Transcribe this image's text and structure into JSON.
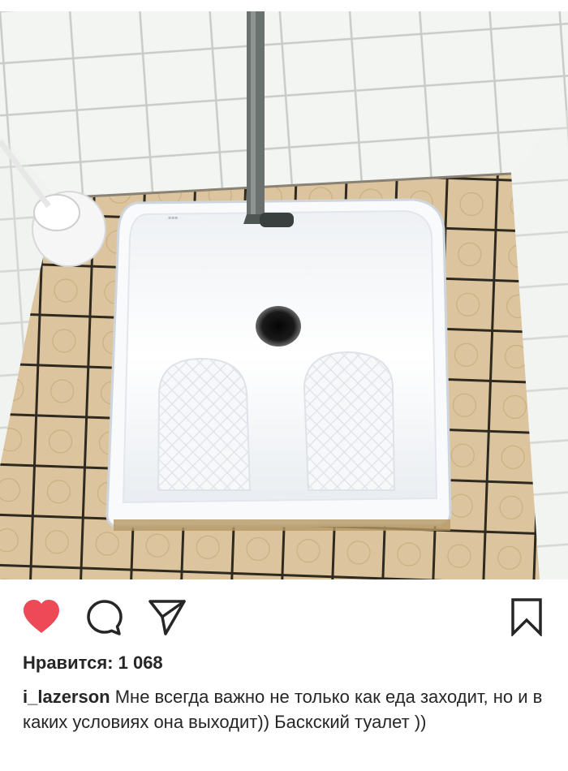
{
  "post": {
    "photo": {
      "icon": "squat-toilet-photo",
      "colors": {
        "wall_tile": "#f2f4f2",
        "floor_tile": "#d9c29a",
        "grout": "#3b3427",
        "porcelain": "#fbfcfd",
        "pipe": "#6b716f"
      }
    },
    "actions": {
      "like_icon": "heart-icon",
      "comment_icon": "comment-icon",
      "share_icon": "send-icon",
      "save_icon": "bookmark-icon",
      "liked": true,
      "like_color": "#ed4956"
    },
    "likes_label": "Нравится: 1 068",
    "caption": {
      "username": "i_lazerson",
      "text": "Мне всегда важно не только как еда заходит, но и в каких условиях она выходит)) Баскский туалет ))"
    }
  }
}
